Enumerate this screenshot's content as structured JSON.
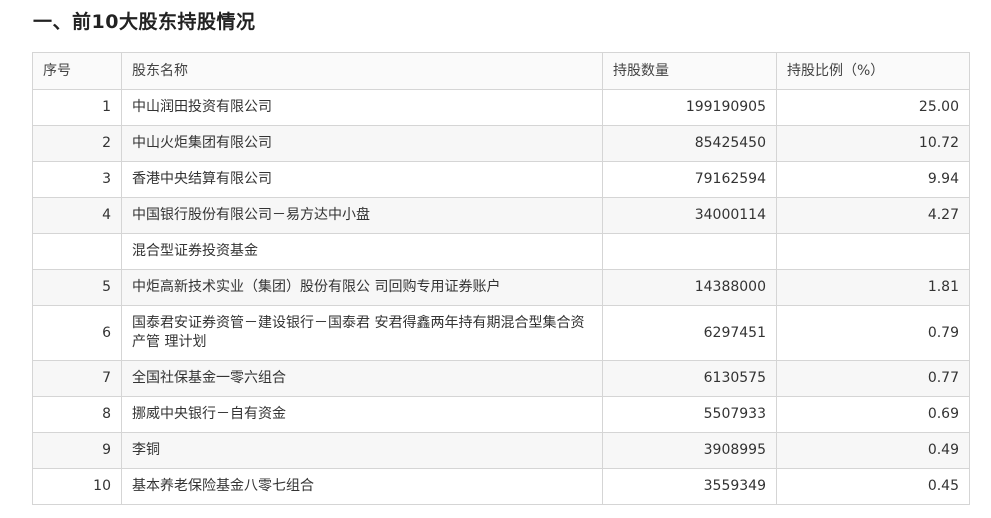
{
  "section": {
    "title": "一、前10大股东持股情况"
  },
  "table": {
    "headers": [
      "序号",
      "股东名称",
      "持股数量",
      "持股比例（%）"
    ],
    "rows": [
      {
        "rank": "1",
        "name": "中山润田投资有限公司",
        "shares": "199190905",
        "ratio": "25.00"
      },
      {
        "rank": "2",
        "name": "中山火炬集团有限公司",
        "shares": "85425450",
        "ratio": "10.72"
      },
      {
        "rank": "3",
        "name": "香港中央结算有限公司",
        "shares": "79162594",
        "ratio": "9.94"
      },
      {
        "rank": "4",
        "name": "中国银行股份有限公司－易方达中小盘",
        "shares": "34000114",
        "ratio": "4.27"
      },
      {
        "rank": "",
        "name": "混合型证券投资基金",
        "shares": "",
        "ratio": ""
      },
      {
        "rank": "5",
        "name": "中炬高新技术实业（集团）股份有限公 司回购专用证券账户",
        "shares": "14388000",
        "ratio": "1.81"
      },
      {
        "rank": "6",
        "name": "国泰君安证券资管－建设银行－国泰君 安君得鑫两年持有期混合型集合资产管 理计划",
        "shares": "6297451",
        "ratio": "0.79"
      },
      {
        "rank": "7",
        "name": "全国社保基金一零六组合",
        "shares": "6130575",
        "ratio": "0.77"
      },
      {
        "rank": "8",
        "name": "挪威中央银行－自有资金",
        "shares": "5507933",
        "ratio": "0.69"
      },
      {
        "rank": "9",
        "name": "李铜",
        "shares": "3908995",
        "ratio": "0.49"
      },
      {
        "rank": "10",
        "name": "基本养老保险基金八零七组合",
        "shares": "3559349",
        "ratio": "0.45"
      }
    ]
  }
}
